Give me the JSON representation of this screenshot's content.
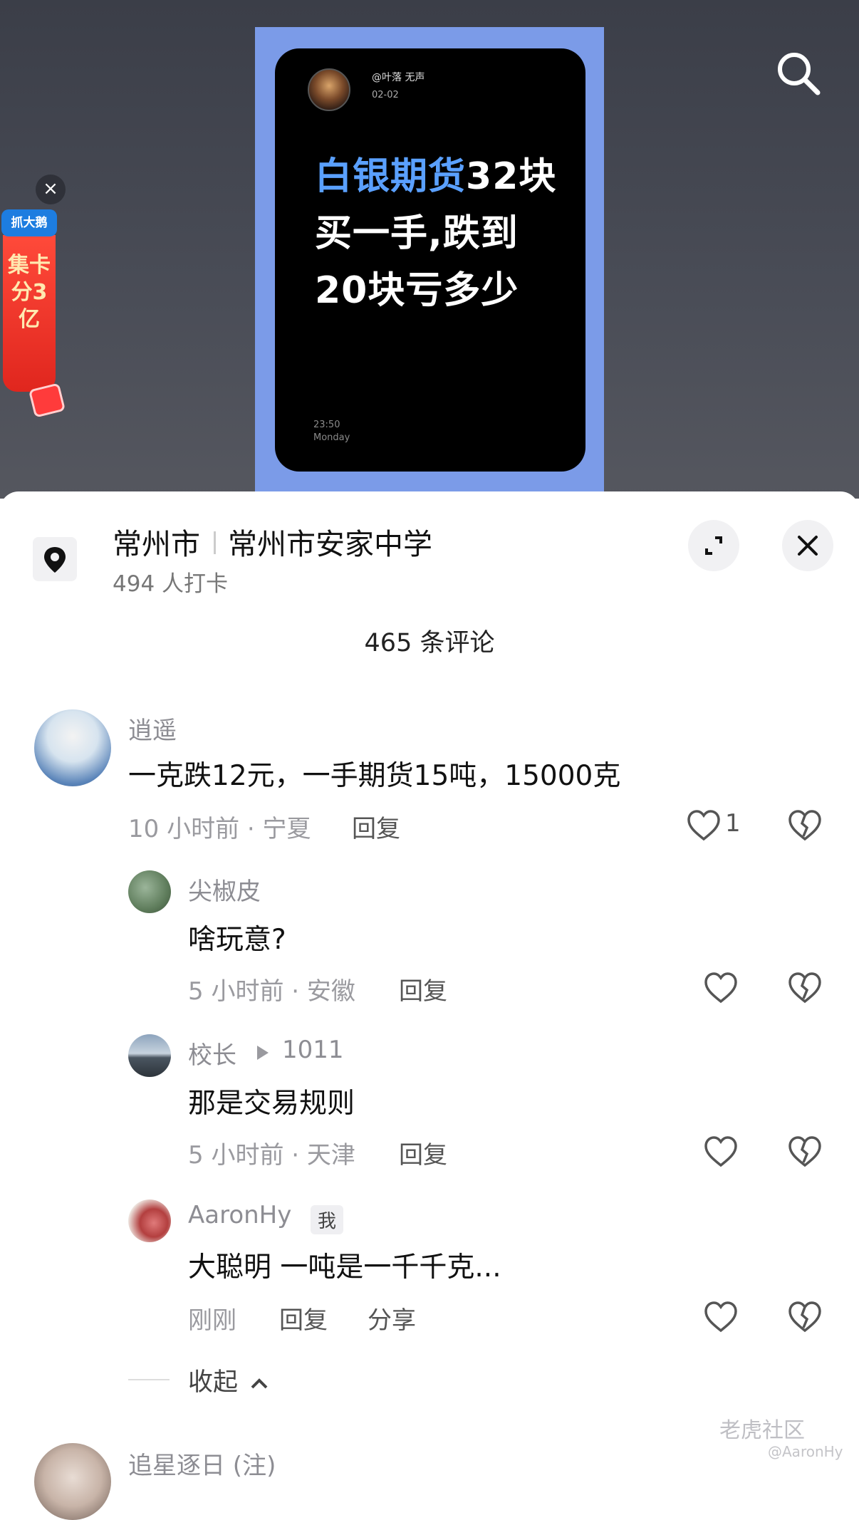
{
  "video": {
    "card": {
      "username": "@叶落 无声",
      "date": "02-02",
      "title_highlight": "白银期货",
      "title_rest": "32块买一手,跌到20块亏多少",
      "time": "23:50",
      "weekday": "Monday"
    },
    "promo": {
      "tag": "抓大鹅",
      "text": "集卡分3亿"
    }
  },
  "sheet": {
    "location": {
      "city": "常州市",
      "place": "常州市安家中学",
      "checkins": "494 人打卡"
    },
    "comment_count": "465 条评论",
    "comments": [
      {
        "user": "逍遥",
        "text": "一克跌12元，一手期货15吨，15000克",
        "meta": "10 小时前 · 宁夏",
        "reply": "回复",
        "likes": "1"
      }
    ],
    "replies": [
      {
        "user": "尖椒皮",
        "text": "啥玩意?",
        "meta": "5 小时前 · 安徽",
        "reply": "回复"
      },
      {
        "user": "校长",
        "reply_to": "1011",
        "text": "那是交易规则",
        "meta": "5 小时前 · 天津",
        "reply": "回复"
      },
      {
        "user": "AaronHy",
        "badge": "我",
        "text": "大聪明 一吨是一千千克...",
        "meta": "刚刚",
        "reply": "回复",
        "share": "分享"
      }
    ],
    "collapse": "收起",
    "next_comment_user": "追星逐日 (注)"
  },
  "watermark": {
    "brand": "老虎社区",
    "handle": "@AaronHy"
  },
  "icons": {
    "search": "search-icon",
    "location": "location-pin-icon",
    "expand": "expand-icon",
    "close": "close-icon",
    "like": "heart-icon",
    "dislike": "broken-heart-icon"
  }
}
